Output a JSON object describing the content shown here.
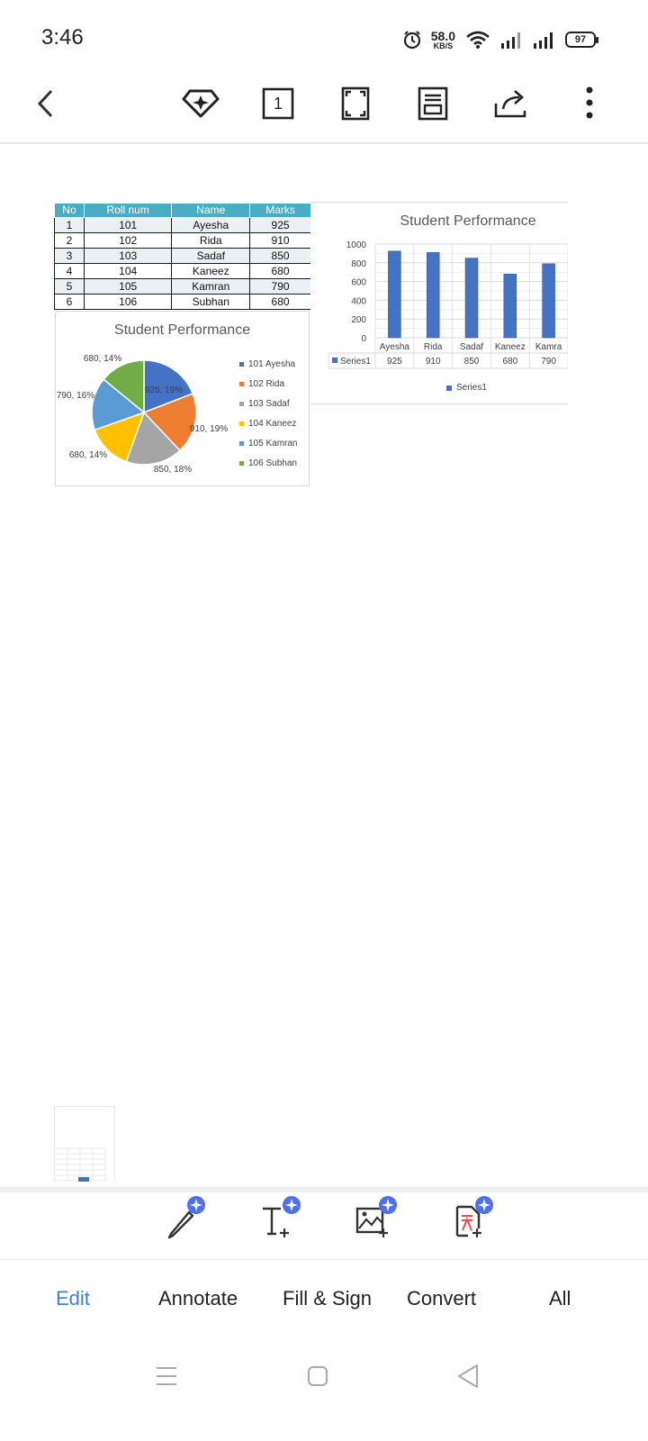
{
  "status_bar": {
    "time": "3:46",
    "net_speed_value": "58.0",
    "net_speed_unit": "KB/S",
    "battery": "97",
    "icons": [
      "alarm-icon",
      "wifi-icon",
      "signal-icon",
      "signal-icon"
    ]
  },
  "toolbar": {
    "page_number": "1",
    "icons": [
      "back-icon",
      "premium-diamond-icon",
      "page-number-icon",
      "fullscreen-icon",
      "reading-mode-icon",
      "share-icon",
      "more-icon"
    ]
  },
  "document": {
    "table": {
      "headers": [
        "No",
        "Roll num",
        "Name",
        "Marks"
      ],
      "rows": [
        [
          "1",
          "101",
          "Ayesha",
          "925"
        ],
        [
          "2",
          "102",
          "Rida",
          "910"
        ],
        [
          "3",
          "103",
          "Sadaf",
          "850"
        ],
        [
          "4",
          "104",
          "Kaneez",
          "680"
        ],
        [
          "5",
          "105",
          "Kamran",
          "790"
        ],
        [
          "6",
          "106",
          "Subhan",
          "680"
        ]
      ]
    }
  },
  "chart_data": [
    {
      "type": "pie",
      "title": "Student Performance",
      "categories": [
        "101 Ayesha",
        "102 Rida",
        "103 Sadaf",
        "104 Kaneez",
        "105 Kamran",
        "106 Subhan"
      ],
      "values": [
        925,
        910,
        850,
        680,
        790,
        680
      ],
      "data_labels": [
        "925, 19%",
        "910, 19%",
        "850, 18%",
        "680, 14%",
        "790, 16%",
        "680, 14%"
      ],
      "colors": [
        "#4472c4",
        "#ed7d31",
        "#a5a5a5",
        "#ffc000",
        "#5b9bd5",
        "#70ad47"
      ],
      "legend": "right"
    },
    {
      "type": "bar",
      "title": "Student Performance",
      "categories": [
        "Ayesha",
        "Rida",
        "Sadaf",
        "Kaneez",
        "Kamra"
      ],
      "series": [
        {
          "name": "Series1",
          "values": [
            925,
            910,
            850,
            680,
            790
          ]
        }
      ],
      "ylim": [
        0,
        1000
      ],
      "yticks": [
        "0",
        "200",
        "400",
        "600",
        "800",
        "1000"
      ],
      "grid": true,
      "color": "#4472c4",
      "data_table": true,
      "legend": "bottom"
    }
  ],
  "bottom_tools": {
    "icons": [
      "edit-pen-icon",
      "add-text-icon",
      "add-image-icon",
      "pdf-convert-icon"
    ]
  },
  "tabs": [
    {
      "label": "Edit",
      "active": true
    },
    {
      "label": "Annotate",
      "active": false
    },
    {
      "label": "Fill & Sign",
      "active": false
    },
    {
      "label": "Convert",
      "active": false
    },
    {
      "label": "All",
      "active": false
    }
  ],
  "nav": {
    "icons": [
      "menu-icon",
      "home-icon",
      "back-icon"
    ]
  }
}
